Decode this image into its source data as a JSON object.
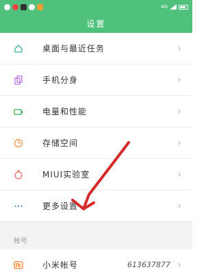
{
  "status_bar": {
    "carrier_left": "",
    "network": "4G",
    "time": ""
  },
  "header": {
    "title": "设置"
  },
  "settings_items": [
    {
      "name": "desktop",
      "label": "桌面与最近任务",
      "icon": "home-icon"
    },
    {
      "name": "clone",
      "label": "手机分身",
      "icon": "clone-icon"
    },
    {
      "name": "battery",
      "label": "电量和性能",
      "icon": "battery-icon"
    },
    {
      "name": "storage",
      "label": "存储空间",
      "icon": "storage-icon"
    },
    {
      "name": "lab",
      "label": "MIUI实验室",
      "icon": "flask-icon"
    },
    {
      "name": "more",
      "label": "更多设置",
      "icon": "more-icon"
    }
  ],
  "account_section": {
    "header": "帐号",
    "items": [
      {
        "name": "mi-account",
        "label": "小米帐号",
        "value": "613637877",
        "icon": "mi-icon"
      }
    ]
  },
  "colors": {
    "accent": "#4fc17c",
    "annotation": "#d42a2a"
  }
}
